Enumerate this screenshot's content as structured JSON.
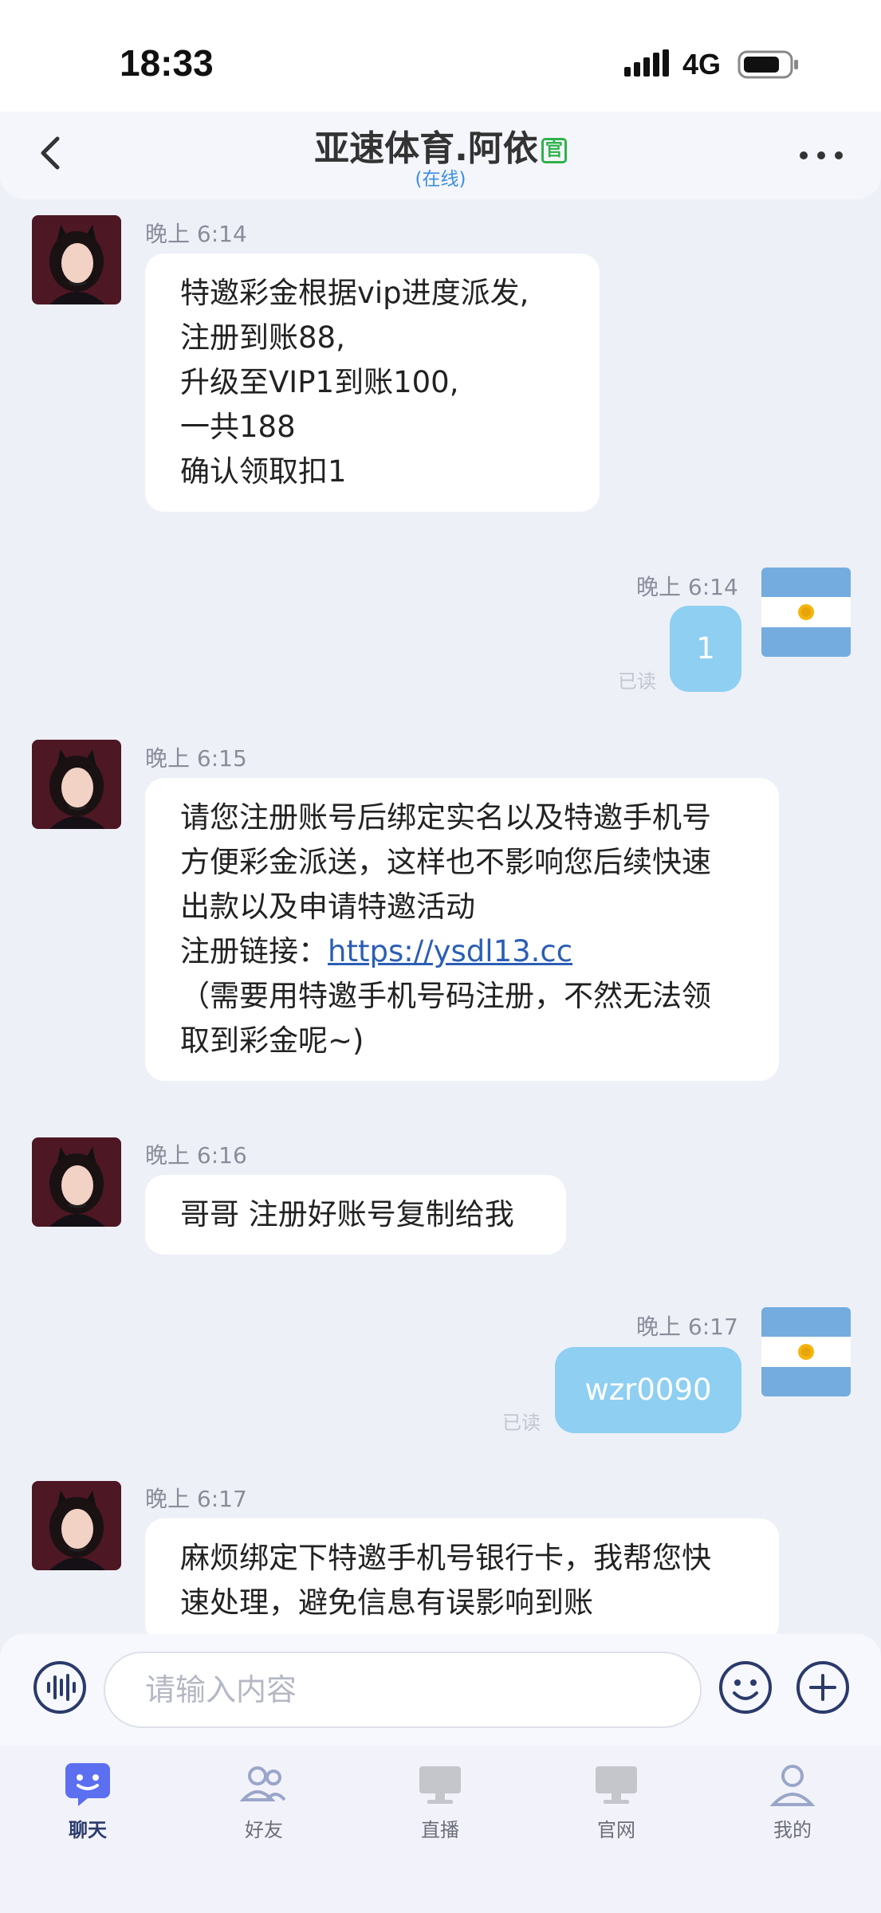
{
  "status_bar": {
    "time": "18:33",
    "network": "4G",
    "battery_icon": "battery-icon",
    "signal_icon": "signal-icon"
  },
  "header": {
    "title": "亚速体育.阿依",
    "official_badge": "官",
    "status": "(在线)"
  },
  "messages": [
    {
      "side": "in",
      "time": "晚上 6:14",
      "lines": [
        "特邀彩金根据vip进度派发,",
        "注册到账88,",
        "升级至VIP1到账100,",
        "一共188",
        "确认领取扣1"
      ]
    },
    {
      "side": "out",
      "time": "晚上 6:14",
      "text": "1",
      "read": "已读"
    },
    {
      "side": "in",
      "time": "晚上 6:15",
      "lines": [
        "请您注册账号后绑定实名以及特邀手机号",
        "方便彩金派送，这样也不影响您后续快速",
        "出款以及申请特邀活动"
      ],
      "link_prefix": "注册链接：",
      "link": "https://ysdl13.cc",
      "lines_after": [
        "（需要用特邀手机号码注册，不然无法领",
        "取到彩金呢~)"
      ]
    },
    {
      "side": "in",
      "time": "晚上 6:16",
      "text": "哥哥 注册好账号复制给我"
    },
    {
      "side": "out",
      "time": "晚上 6:17",
      "text": "wzr0090",
      "read": "已读"
    },
    {
      "side": "in",
      "time": "晚上 6:17",
      "lines": [
        "麻烦绑定下特邀手机号银行卡，我帮您快",
        "速处理，避免信息有误影响到账"
      ]
    }
  ],
  "input": {
    "placeholder": "请输入内容"
  },
  "tabs": [
    {
      "label": "聊天",
      "icon": "chat-icon",
      "active": true
    },
    {
      "label": "好友",
      "icon": "friends-icon",
      "active": false
    },
    {
      "label": "直播",
      "icon": "monitor-icon",
      "active": false
    },
    {
      "label": "官网",
      "icon": "monitor-icon",
      "active": false
    },
    {
      "label": "我的",
      "icon": "profile-icon",
      "active": false
    }
  ],
  "colors": {
    "accent": "#2a3a6b",
    "bubble_out": "#8ecff2",
    "link": "#2b5eb5",
    "online": "#3a8ee6",
    "official": "#2fb24a"
  }
}
